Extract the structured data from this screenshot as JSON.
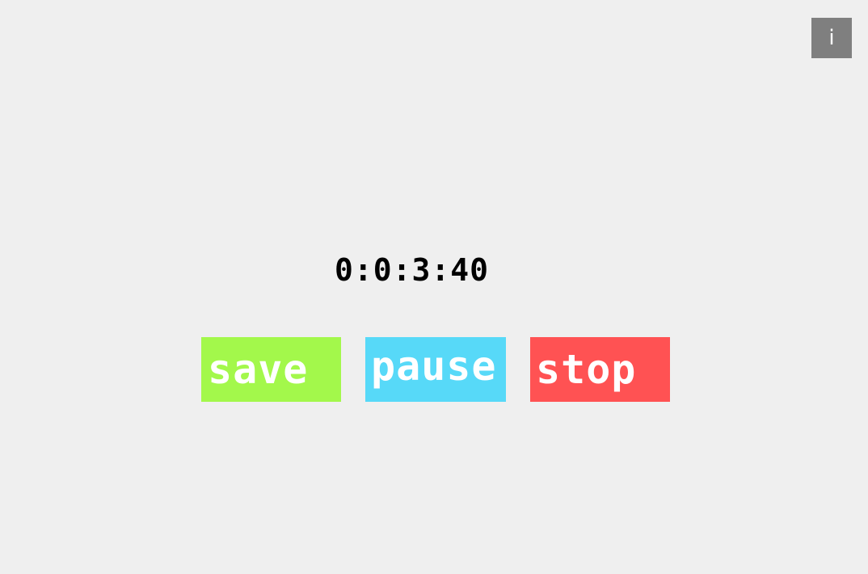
{
  "info": {
    "label": "i"
  },
  "timer": {
    "value": "0:0:3:40"
  },
  "controls": {
    "save_label": "save",
    "pause_label": "pause",
    "stop_label": "stop"
  },
  "colors": {
    "background": "#efefef",
    "info": "#7f7f7f",
    "save": "#a3f84b",
    "pause": "#57d9f8",
    "stop": "#ff5253"
  }
}
